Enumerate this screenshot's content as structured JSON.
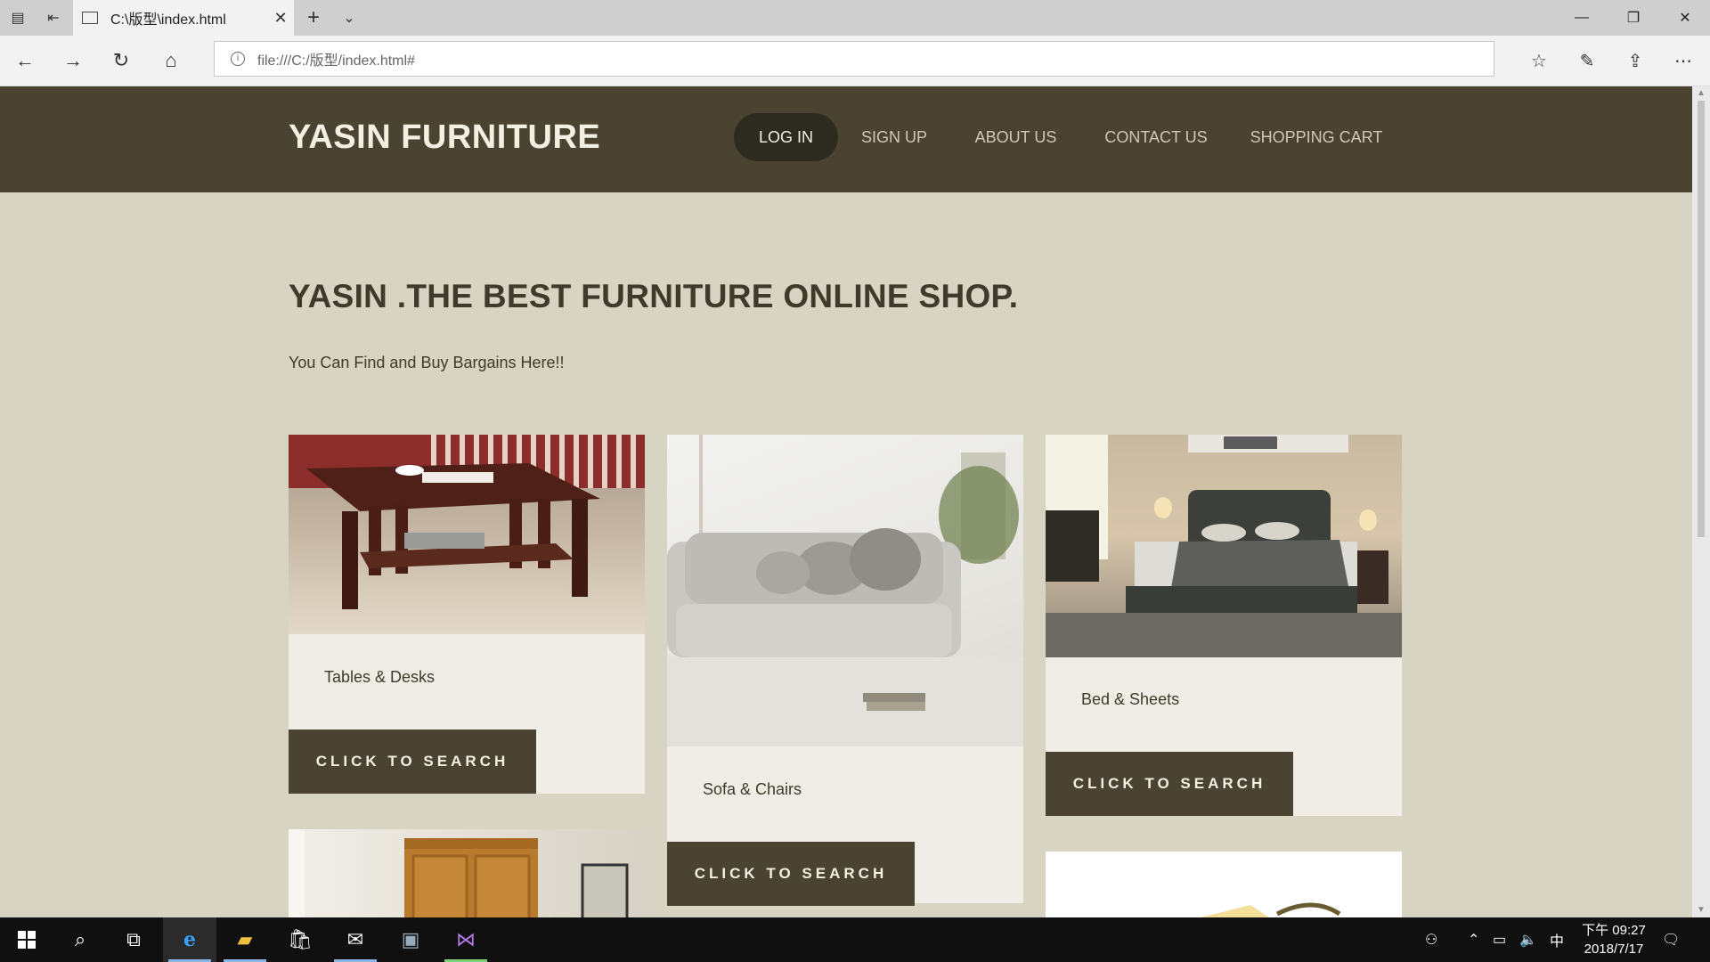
{
  "browser": {
    "tab_title": "C:\\版型\\index.html",
    "url": "file:///C:/版型/index.html#",
    "tab_close": "✕",
    "new_tab": "+",
    "tab_list": "⌄"
  },
  "site": {
    "logo": "YASIN FURNITURE",
    "menu": [
      "LOG IN",
      "SIGN UP",
      "ABOUT US",
      "CONTACT US",
      "SHOPPING CART"
    ],
    "active_menu": "LOG IN",
    "headline": "YASIN .THE BEST FURNITURE ONLINE SHOP.",
    "subline": "You Can Find and Buy Bargains Here!!",
    "cards": [
      {
        "caption": "Tables & Desks",
        "button": "CLICK TO SEARCH"
      },
      {
        "caption": "Sofa & Chairs",
        "button": "CLICK TO SEARCH"
      },
      {
        "caption": "Bed & Sheets",
        "button": "CLICK TO SEARCH"
      }
    ]
  },
  "taskbar": {
    "ime": "中",
    "time": "下午 09:27",
    "date": "2018/7/17"
  },
  "colors": {
    "header_bg": "#4a4331",
    "page_bg": "#d8d4c3",
    "card_bg": "#efede6",
    "button_bg": "#4a4331"
  }
}
